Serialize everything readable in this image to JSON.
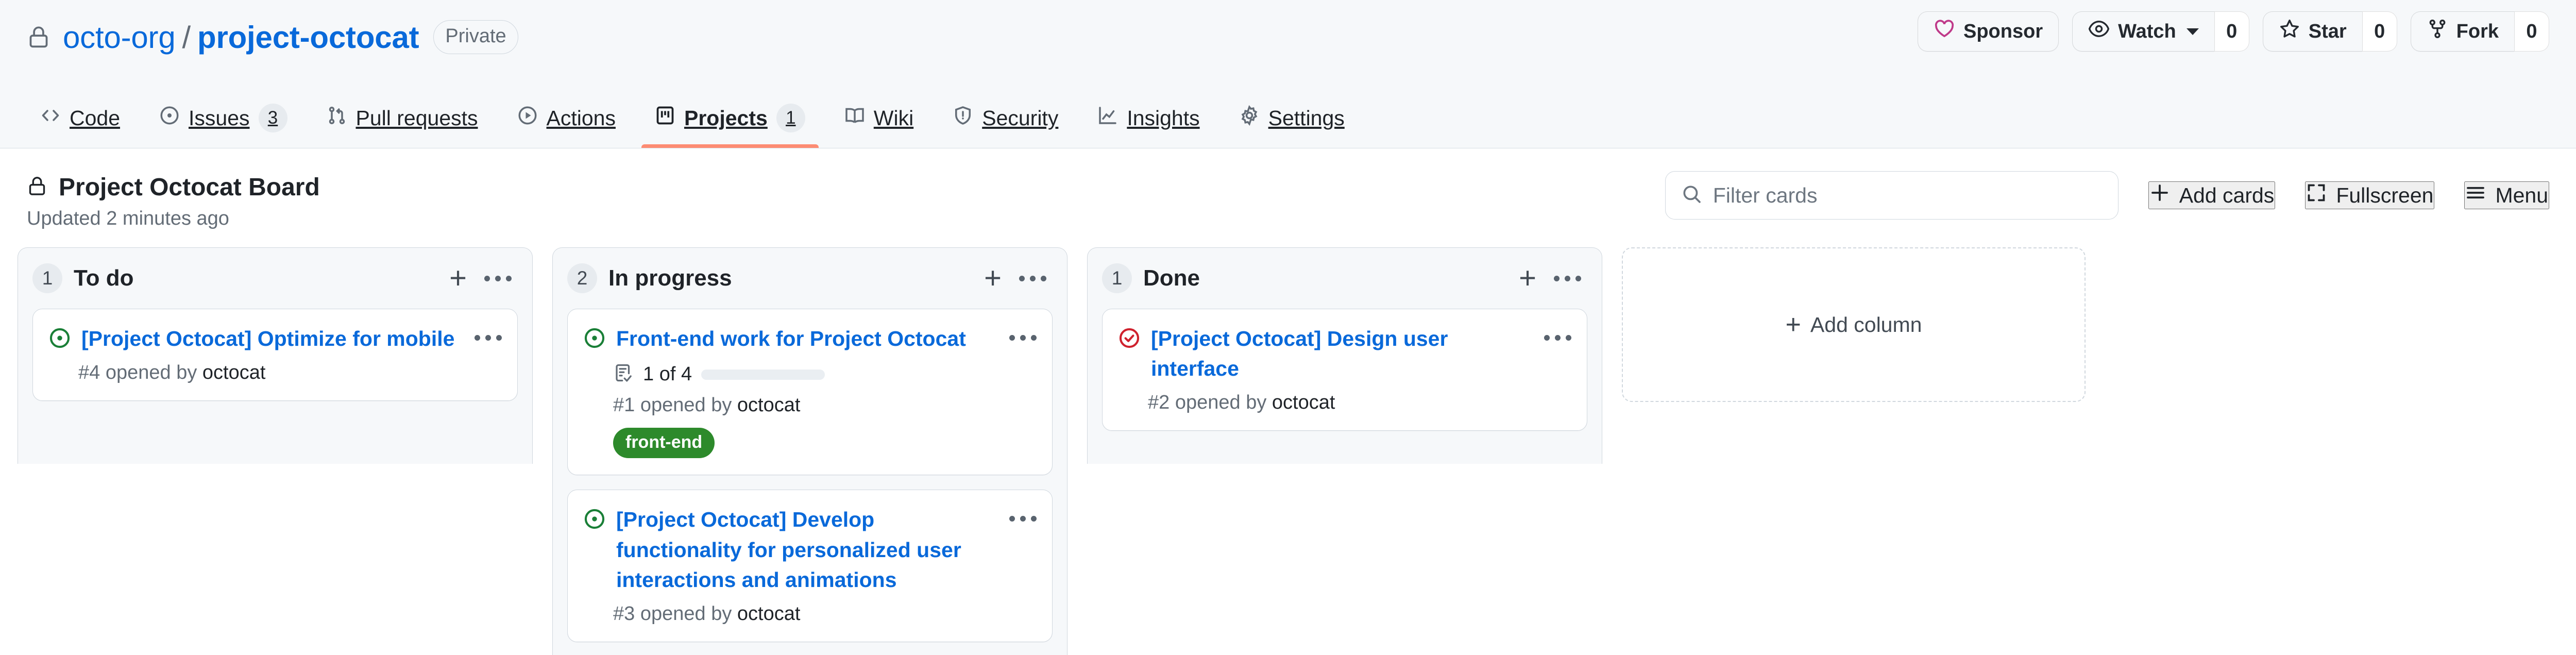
{
  "repo": {
    "owner": "octo-org",
    "separator": "/",
    "name": "project-octocat",
    "visibility": "Private",
    "actions": {
      "sponsor_label": "Sponsor",
      "watch_label": "Watch",
      "watch_count": "0",
      "star_label": "Star",
      "star_count": "0",
      "fork_label": "Fork",
      "fork_count": "0"
    },
    "nav": [
      {
        "label": "Code",
        "counter": "",
        "active": false
      },
      {
        "label": "Issues",
        "counter": "3",
        "active": false
      },
      {
        "label": "Pull requests",
        "counter": "",
        "active": false
      },
      {
        "label": "Actions",
        "counter": "",
        "active": false
      },
      {
        "label": "Projects",
        "counter": "1",
        "active": true
      },
      {
        "label": "Wiki",
        "counter": "",
        "active": false
      },
      {
        "label": "Security",
        "counter": "",
        "active": false
      },
      {
        "label": "Insights",
        "counter": "",
        "active": false
      },
      {
        "label": "Settings",
        "counter": "",
        "active": false
      }
    ]
  },
  "project": {
    "title": "Project Octocat Board",
    "updated": "Updated 2 minutes ago",
    "filter_placeholder": "Filter cards",
    "filter_value": "",
    "add_cards_label": "Add cards",
    "fullscreen_label": "Fullscreen",
    "menu_label": "Menu"
  },
  "board": {
    "add_column_label": "Add column",
    "columns": [
      {
        "name": "To do",
        "count": "1",
        "cards": [
          {
            "title": "[Project Octocat] Optimize for mobile",
            "meta_number": "#4",
            "meta_text": "opened by",
            "author": "octocat",
            "state": "open",
            "tasks": null,
            "labels": []
          }
        ]
      },
      {
        "name": "In progress",
        "count": "2",
        "cards": [
          {
            "title": "Front-end work for Project Octocat",
            "meta_number": "#1",
            "meta_text": "opened by",
            "author": "octocat",
            "state": "open",
            "tasks": {
              "text": "1 of 4",
              "done": 1,
              "total": 4,
              "percent": 25
            },
            "labels": [
              {
                "name": "front-end",
                "color": "#2d8a2b"
              }
            ]
          },
          {
            "title": "[Project Octocat] Develop functionality for personalized user interactions and animations",
            "meta_number": "#3",
            "meta_text": "opened by",
            "author": "octocat",
            "state": "open",
            "tasks": null,
            "labels": []
          }
        ]
      },
      {
        "name": "Done",
        "count": "1",
        "cards": [
          {
            "title": "[Project Octocat] Design user interface",
            "meta_number": "#2",
            "meta_text": "opened by",
            "author": "octocat",
            "state": "closed",
            "tasks": null,
            "labels": []
          }
        ]
      }
    ]
  },
  "colors": {
    "link": "#0969da",
    "accent_underline": "#fd8c73",
    "issue_open": "#1a7f37",
    "issue_closed": "#cf222e",
    "sponsor_heart": "#bf3989",
    "header_bg": "#f6f8fa",
    "border": "#d0d7de"
  }
}
